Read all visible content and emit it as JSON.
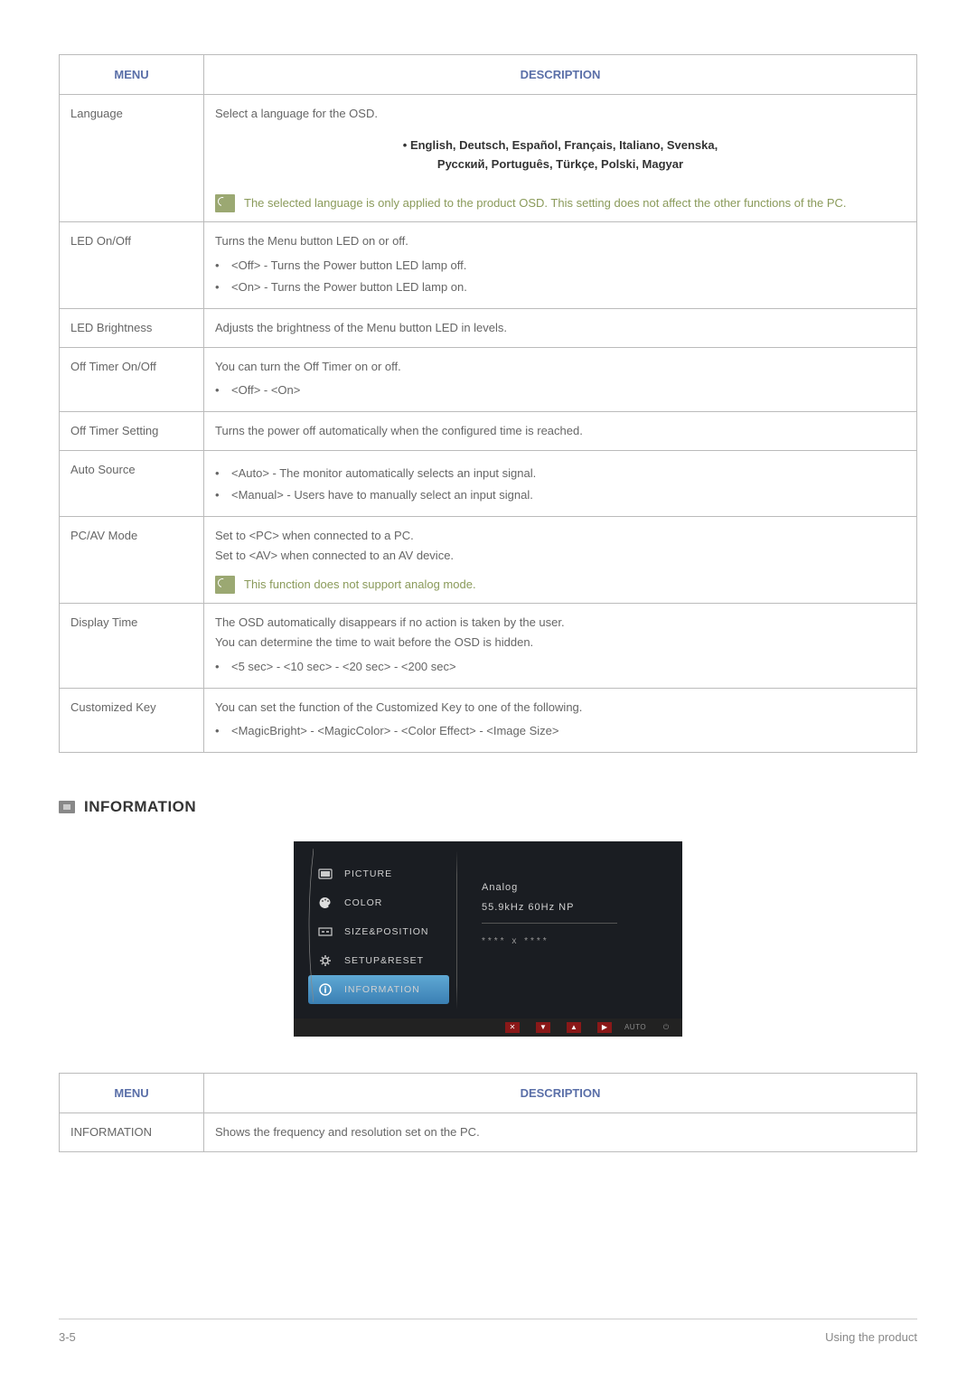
{
  "table1": {
    "headers": {
      "menu": "MENU",
      "desc": "DESCRIPTION"
    },
    "rows": {
      "language": {
        "menu": "Language",
        "intro": "Select a language for the OSD.",
        "langs_line1": "• English, Deutsch, Español, Français, Italiano, Svenska,",
        "langs_line2": "Русский, Português, Türkçe, Polski, Magyar",
        "note": "The selected language is only applied to the product OSD. This setting does not affect the other functions of the PC."
      },
      "led_onoff": {
        "menu": "LED On/Off",
        "intro": "Turns the Menu button LED on or off.",
        "b1": "<Off> - Turns the Power button LED lamp off.",
        "b2": "<On> - Turns the Power button LED lamp on."
      },
      "led_brightness": {
        "menu": "LED Brightness",
        "desc": "Adjusts the brightness of the Menu button LED in levels."
      },
      "off_timer_onoff": {
        "menu": "Off Timer On/Off",
        "intro": "You can turn the Off Timer on or off.",
        "b1": "<Off> - <On>"
      },
      "off_timer_setting": {
        "menu": "Off Timer Setting",
        "desc": "Turns the power off automatically when the configured time is reached."
      },
      "auto_source": {
        "menu": "Auto Source",
        "b1": "<Auto> - The monitor automatically selects an input signal.",
        "b2": "<Manual> - Users have to manually select an input signal."
      },
      "pcav": {
        "menu": "PC/AV Mode",
        "l1": "Set to <PC> when connected to a PC.",
        "l2": "Set to <AV> when connected to an AV device.",
        "note": "This function does not support analog mode."
      },
      "display_time": {
        "menu": "Display Time",
        "l1": "The OSD automatically disappears if no action is taken by the user.",
        "l2": "You can determine the time to wait before the OSD is hidden.",
        "b1": "<5 sec> - <10 sec> - <20 sec> - <200 sec>"
      },
      "customized_key": {
        "menu": "Customized Key",
        "l1": "You can set the function of the Customized Key to one of the following.",
        "b1": "<MagicBright> - <MagicColor> - <Color Effect> - <Image Size>"
      }
    }
  },
  "section": {
    "title": "INFORMATION"
  },
  "osd": {
    "items": {
      "picture": "PICTURE",
      "color": "COLOR",
      "size": "SIZE&POSITION",
      "setup": "SETUP&RESET",
      "info": "INFORMATION"
    },
    "right": {
      "signal": "Analog",
      "freq": "55.9kHz 60Hz NP",
      "res": "**** x ****"
    },
    "footer": {
      "auto": "AUTO"
    }
  },
  "table2": {
    "headers": {
      "menu": "MENU",
      "desc": "DESCRIPTION"
    },
    "row": {
      "menu": "INFORMATION",
      "desc": "Shows the frequency and resolution set on the PC."
    }
  },
  "footer": {
    "left": "3-5",
    "right": "Using the product"
  }
}
